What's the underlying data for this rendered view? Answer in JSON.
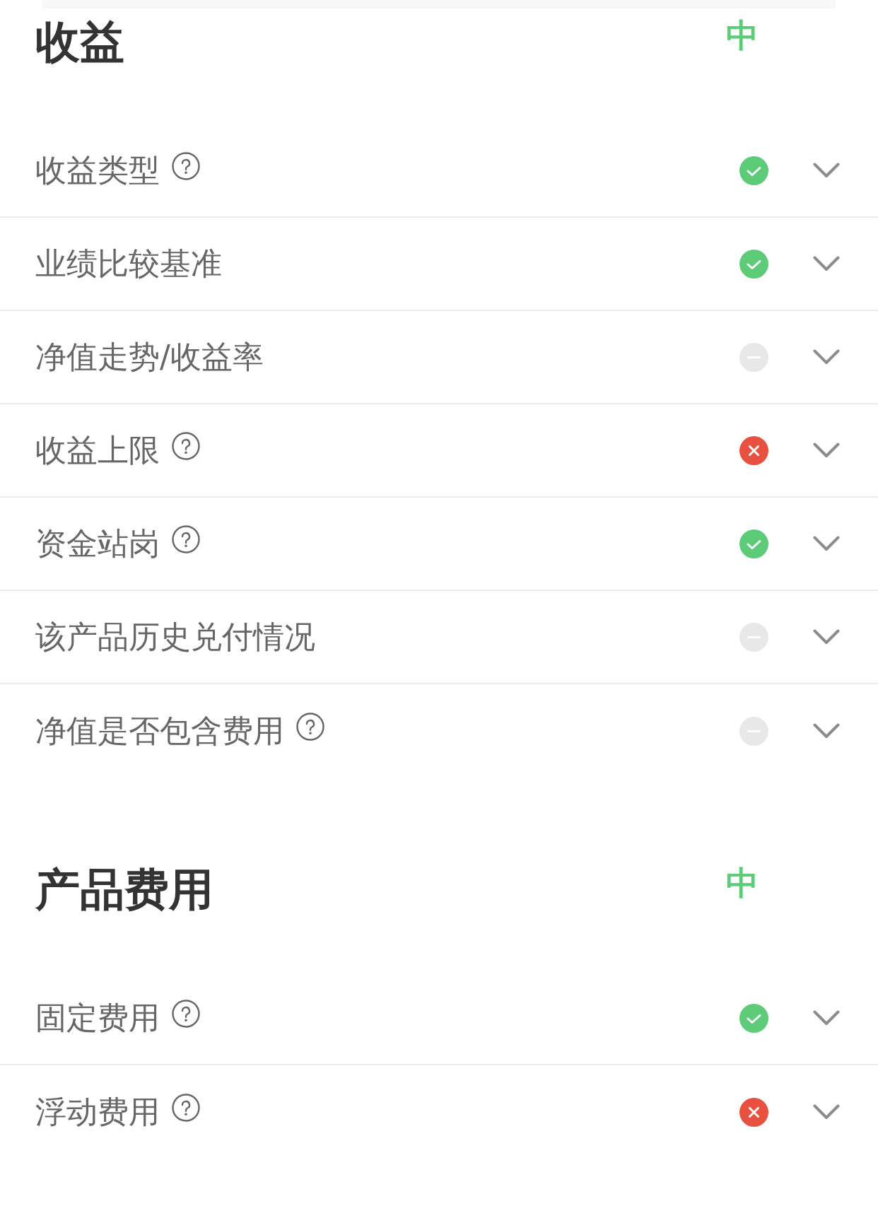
{
  "sections": [
    {
      "title": "收益",
      "rating": "中",
      "items": [
        {
          "label": "收益类型",
          "help": true,
          "kind": "pass",
          "expanded": false
        },
        {
          "label": "业绩比较基准",
          "help": false,
          "kind": "pass",
          "expanded": false
        },
        {
          "label": "净值走势/收益率",
          "help": false,
          "kind": "none",
          "expanded": false
        },
        {
          "label": "收益上限",
          "help": true,
          "kind": "fail",
          "expanded": false
        },
        {
          "label": "资金站岗",
          "help": true,
          "kind": "pass",
          "expanded": false
        },
        {
          "label": "该产品历史兑付情况",
          "help": false,
          "kind": "none",
          "expanded": false
        },
        {
          "label": "净值是否包含费用",
          "help": true,
          "kind": "none",
          "expanded": false
        }
      ]
    },
    {
      "title": "产品费用",
      "rating": "中",
      "items": [
        {
          "label": "固定费用",
          "help": true,
          "kind": "pass",
          "expanded": false
        },
        {
          "label": "浮动费用",
          "help": true,
          "kind": "fail",
          "expanded": false
        }
      ]
    }
  ]
}
